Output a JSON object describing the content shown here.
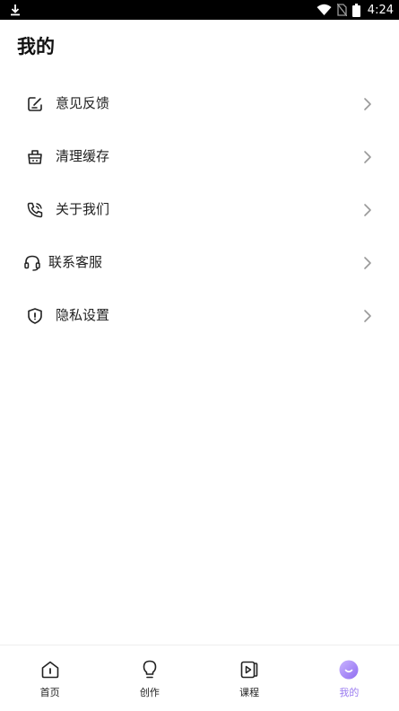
{
  "status_bar": {
    "time": "4:24",
    "icons": [
      "download-icon",
      "wifi-icon",
      "no-sim-icon",
      "battery-icon"
    ]
  },
  "page": {
    "title": "我的"
  },
  "menu": {
    "items": [
      {
        "label": "意见反馈",
        "icon": "feedback-edit-icon"
      },
      {
        "label": "清理缓存",
        "icon": "basket-icon"
      },
      {
        "label": "关于我们",
        "icon": "phone-icon"
      },
      {
        "label": "联系客服",
        "icon": "headset-icon"
      },
      {
        "label": "隐私设置",
        "icon": "shield-icon"
      }
    ]
  },
  "bottom_nav": {
    "items": [
      {
        "label": "首页",
        "icon": "home-icon",
        "active": false
      },
      {
        "label": "创作",
        "icon": "lightbulb-icon",
        "active": false
      },
      {
        "label": "课程",
        "icon": "video-play-icon",
        "active": false
      },
      {
        "label": "我的",
        "icon": "profile-smile-icon",
        "active": true
      }
    ]
  },
  "colors": {
    "accent": "#9b7cf0",
    "text": "#222222",
    "status_bar": "#000000"
  }
}
